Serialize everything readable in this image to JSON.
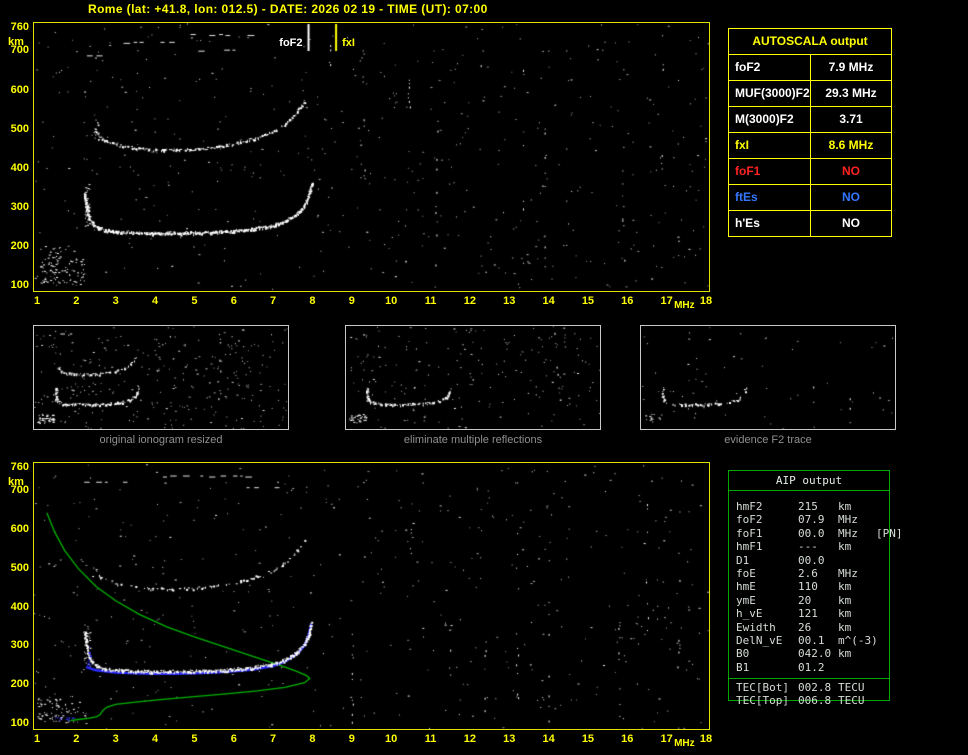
{
  "header": {
    "title": "Rome (lat: +41.8, lon: 012.5) - DATE: 2026 02 19 - TIME (UT): 07:00"
  },
  "colors": {
    "white": "#ffffff",
    "yellow": "#ffff00",
    "red": "#ff2222",
    "blue": "#3377ff",
    "green": "#00b400",
    "trace_blue": "#2a2aff",
    "gray": "#8f8f8f"
  },
  "axes": {
    "y_unit": "km",
    "x_unit": "MHz",
    "y_ticks": [
      {
        "label": "760",
        "km": 760
      },
      {
        "label": "700",
        "km": 700
      },
      {
        "label": "600",
        "km": 600
      },
      {
        "label": "500",
        "km": 500
      },
      {
        "label": "400",
        "km": 400
      },
      {
        "label": "300",
        "km": 300
      },
      {
        "label": "200",
        "km": 200
      },
      {
        "label": "100",
        "km": 100
      }
    ],
    "x_ticks": [
      {
        "label": "1",
        "f": 1
      },
      {
        "label": "2",
        "f": 2
      },
      {
        "label": "3",
        "f": 3
      },
      {
        "label": "4",
        "f": 4
      },
      {
        "label": "5",
        "f": 5
      },
      {
        "label": "6",
        "f": 6
      },
      {
        "label": "7",
        "f": 7
      },
      {
        "label": "8",
        "f": 8
      },
      {
        "label": "9",
        "f": 9
      },
      {
        "label": "10",
        "f": 10
      },
      {
        "label": "11",
        "f": 11
      },
      {
        "label": "12",
        "f": 12
      },
      {
        "label": "13",
        "f": 13
      },
      {
        "label": "14",
        "f": 14
      },
      {
        "label": "15",
        "f": 15
      },
      {
        "label": "16",
        "f": 16
      },
      {
        "label": "17",
        "f": 17
      },
      {
        "label": "18",
        "f": 18
      }
    ]
  },
  "main_plot": {
    "fof2_label": "foF2",
    "fof2_mhz": 7.9,
    "fxi_label": "fxI",
    "fxi_mhz": 8.6
  },
  "autoscala": {
    "title": "AUTOSCALA output",
    "rows": [
      {
        "label": "foF2",
        "value": "7.9 MHz",
        "color": "white"
      },
      {
        "label": "MUF(3000)F2",
        "value": "29.3 MHz",
        "color": "white"
      },
      {
        "label": "M(3000)F2",
        "value": "3.71",
        "color": "white"
      },
      {
        "label": "fxI",
        "value": "8.6 MHz",
        "color": "yellow"
      },
      {
        "label": "foF1",
        "value": "NO",
        "color": "red"
      },
      {
        "label": "ftEs",
        "value": "NO",
        "color": "blue"
      },
      {
        "label": "h'Es",
        "value": "NO",
        "color": "white"
      }
    ]
  },
  "panels": [
    {
      "caption": "original ionogram resized"
    },
    {
      "caption": "eliminate multiple reflections"
    },
    {
      "caption": "evidence F2 trace"
    }
  ],
  "aip": {
    "title": "AIP output",
    "rows": [
      {
        "name": "hmF2",
        "value": "215",
        "unit": "km",
        "note": ""
      },
      {
        "name": "foF2",
        "value": "07.9",
        "unit": "MHz",
        "note": ""
      },
      {
        "name": "foF1",
        "value": "00.0",
        "unit": "MHz",
        "note": "[PN]"
      },
      {
        "name": "hmF1",
        "value": "---",
        "unit": "km",
        "note": ""
      },
      {
        "name": "D1",
        "value": "00.0",
        "unit": "",
        "note": ""
      },
      {
        "name": "foE",
        "value": "2.6",
        "unit": "MHz",
        "note": ""
      },
      {
        "name": "hmE",
        "value": "110",
        "unit": "km",
        "note": ""
      },
      {
        "name": "ymE",
        "value": "20",
        "unit": "km",
        "note": ""
      },
      {
        "name": "h_vE",
        "value": "121",
        "unit": "km",
        "note": ""
      },
      {
        "name": "Ewidth",
        "value": "26",
        "unit": "km",
        "note": ""
      },
      {
        "name": "DelN_vE",
        "value": "00.1",
        "unit": "m^(-3)",
        "note": ""
      },
      {
        "name": "B0",
        "value": "042.0",
        "unit": "km",
        "note": ""
      },
      {
        "name": "B1",
        "value": "01.2",
        "unit": "",
        "note": ""
      }
    ],
    "tec_rows": [
      {
        "name": "TEC[Bot]",
        "value": "002.8",
        "unit": "TECU"
      },
      {
        "name": "TEC[Top]",
        "value": "006.8",
        "unit": "TECU"
      }
    ]
  },
  "ionogram": {
    "x_range_mhz": [
      1,
      18
    ],
    "y_range_km": [
      100,
      760
    ],
    "hop1": [
      [
        2.2,
        338
      ],
      [
        2.25,
        300
      ],
      [
        2.32,
        272
      ],
      [
        2.45,
        252
      ],
      [
        2.7,
        241
      ],
      [
        3,
        237
      ],
      [
        3.5,
        234
      ],
      [
        4,
        233
      ],
      [
        4.5,
        233
      ],
      [
        5,
        234
      ],
      [
        5.5,
        236
      ],
      [
        6,
        239
      ],
      [
        6.5,
        244
      ],
      [
        7,
        253
      ],
      [
        7.3,
        263
      ],
      [
        7.6,
        282
      ],
      [
        7.8,
        305
      ],
      [
        7.9,
        330
      ],
      [
        7.97,
        362
      ]
    ],
    "hop2": [
      [
        2.45,
        500
      ],
      [
        2.6,
        478
      ],
      [
        2.8,
        465
      ],
      [
        3.2,
        455
      ],
      [
        3.6,
        449
      ],
      [
        4,
        447
      ],
      [
        4.5,
        446
      ],
      [
        5,
        448
      ],
      [
        5.5,
        453
      ],
      [
        6,
        462
      ],
      [
        6.5,
        475
      ],
      [
        7,
        494
      ],
      [
        7.3,
        514
      ],
      [
        7.6,
        543
      ],
      [
        7.82,
        575
      ]
    ],
    "blue": [
      [
        2.25,
        244
      ],
      [
        2.5,
        236
      ],
      [
        3,
        230
      ],
      [
        3.5,
        228
      ],
      [
        4,
        227
      ],
      [
        4.5,
        227
      ],
      [
        5,
        228
      ],
      [
        5.5,
        230
      ],
      [
        6,
        233
      ],
      [
        6.5,
        238
      ],
      [
        7,
        247
      ],
      [
        7.3,
        258
      ],
      [
        7.6,
        277
      ],
      [
        7.8,
        300
      ],
      [
        7.9,
        326
      ],
      [
        7.97,
        356
      ]
    ],
    "profile": [
      [
        1.25,
        642
      ],
      [
        1.45,
        592
      ],
      [
        1.7,
        545
      ],
      [
        2.05,
        498
      ],
      [
        2.5,
        452
      ],
      [
        3,
        415
      ],
      [
        3.6,
        380
      ],
      [
        4.3,
        348
      ],
      [
        5,
        322
      ],
      [
        5.8,
        295
      ],
      [
        6.6,
        268
      ],
      [
        7.2,
        248
      ],
      [
        7.6,
        233
      ],
      [
        7.85,
        222
      ],
      [
        7.93,
        215
      ],
      [
        7.8,
        204
      ],
      [
        7.3,
        192
      ],
      [
        6.6,
        183
      ],
      [
        5.8,
        175
      ],
      [
        5,
        168
      ],
      [
        4.2,
        161
      ],
      [
        3.5,
        154
      ],
      [
        3,
        148
      ],
      [
        2.78,
        141
      ],
      [
        2.68,
        133
      ],
      [
        2.63,
        126
      ],
      [
        2.6,
        121
      ],
      [
        2.5,
        116
      ],
      [
        2.3,
        112
      ],
      [
        2.05,
        109
      ],
      [
        1.85,
        106
      ]
    ]
  }
}
